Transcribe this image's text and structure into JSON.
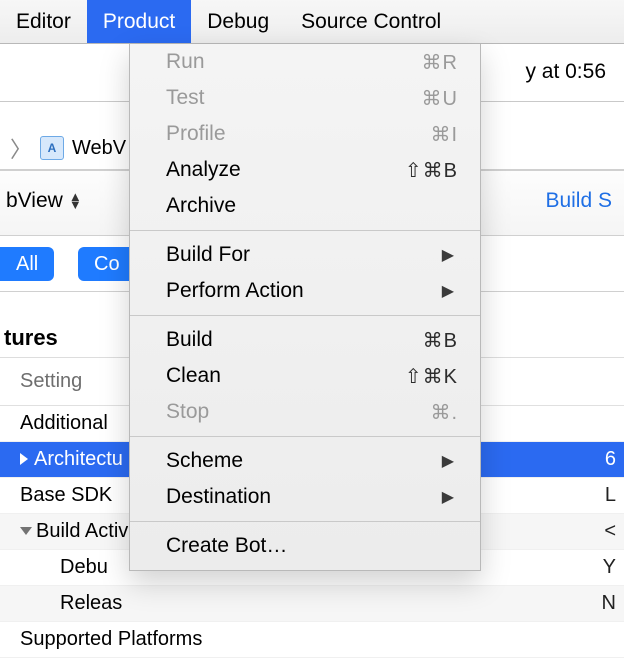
{
  "menubar": {
    "items": [
      {
        "label": "Editor"
      },
      {
        "label": "Product"
      },
      {
        "label": "Debug"
      },
      {
        "label": "Source Control"
      }
    ],
    "selected_index": 1
  },
  "product_menu": [
    {
      "label": "Run",
      "shortcut": "⌘R",
      "disabled": true
    },
    {
      "label": "Test",
      "shortcut": "⌘U",
      "disabled": true
    },
    {
      "label": "Profile",
      "shortcut": "⌘I",
      "disabled": true
    },
    {
      "label": "Analyze",
      "shortcut": "⇧⌘B"
    },
    {
      "label": "Archive"
    },
    {
      "sep": true
    },
    {
      "label": "Build For",
      "submenu": true
    },
    {
      "label": "Perform Action",
      "submenu": true
    },
    {
      "sep": true
    },
    {
      "label": "Build",
      "shortcut": "⌘B"
    },
    {
      "label": "Clean",
      "shortcut": "⇧⌘K"
    },
    {
      "label": "Stop",
      "shortcut": "⌘.",
      "disabled": true
    },
    {
      "sep": true
    },
    {
      "label": "Scheme",
      "submenu": true
    },
    {
      "label": "Destination",
      "submenu": true
    },
    {
      "sep": true
    },
    {
      "label": "Create Bot…"
    }
  ],
  "status_bar": {
    "text_fragment": "y at 0:56"
  },
  "pathbar": {
    "project": "WebV"
  },
  "tabs": {
    "left_fragment": "bView",
    "right_link": "Build S"
  },
  "filter": {
    "all": "All",
    "second_fragment": "Co"
  },
  "settings": {
    "section_fragment": "tures",
    "column_header": "Setting",
    "rows": [
      {
        "label": "Additional",
        "value": ""
      },
      {
        "label": "Architectu",
        "value": "6",
        "selected": true
      },
      {
        "label": "Base SDK",
        "value": "L"
      },
      {
        "label": "Build Activ",
        "value": "<",
        "expandable": true
      },
      {
        "label": "Debu",
        "value": "Y",
        "indent": true
      },
      {
        "label": "Releas",
        "value": "N",
        "indent": true
      },
      {
        "label": "Supported Platforms",
        "value": ""
      }
    ]
  }
}
